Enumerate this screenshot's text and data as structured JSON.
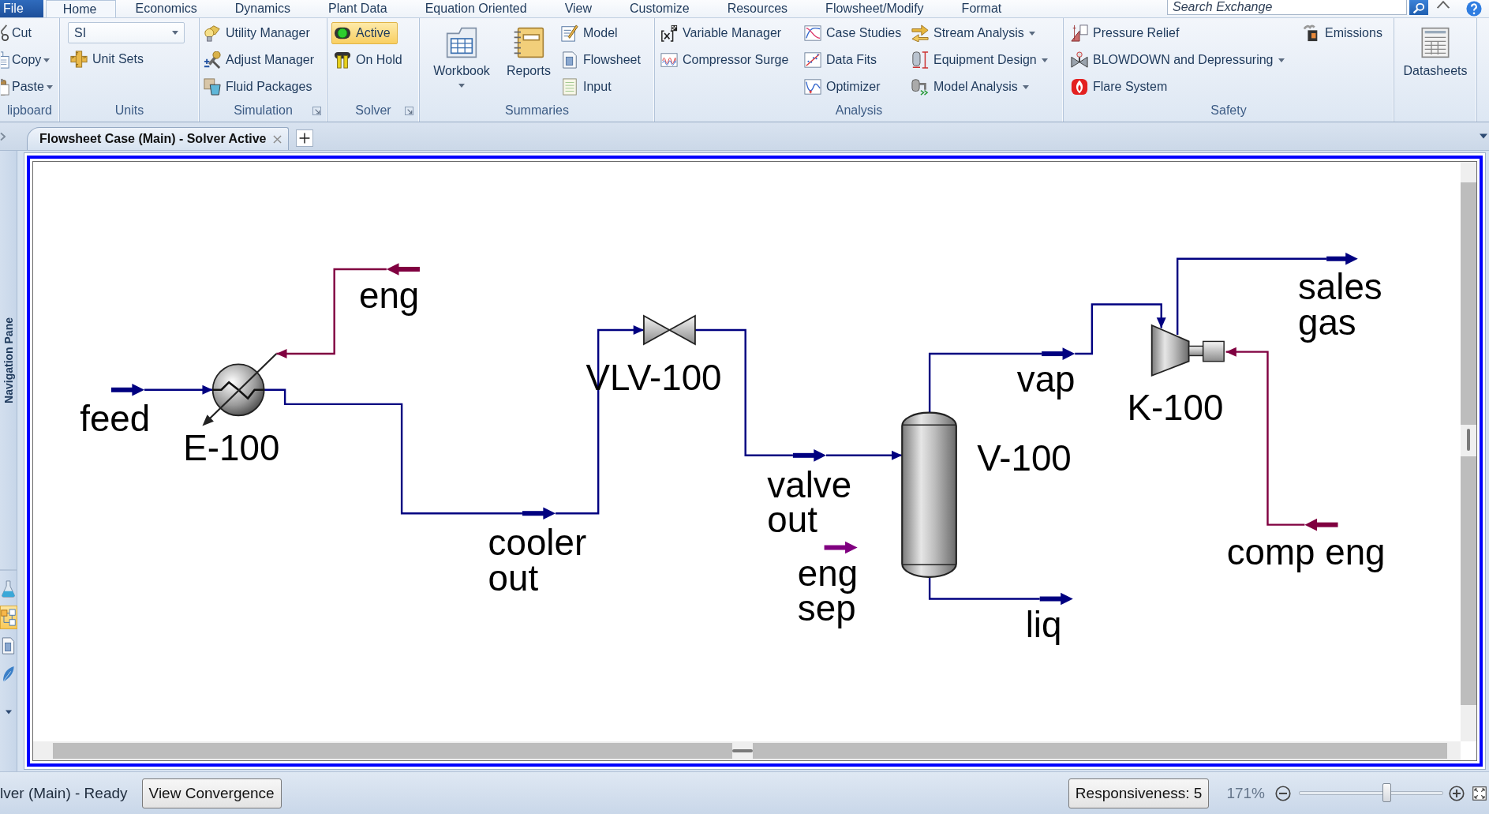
{
  "menu_tabs": [
    {
      "label": "File",
      "kind": "file",
      "selected": false
    },
    {
      "label": "Home",
      "kind": "tab",
      "selected": true
    },
    {
      "label": "Economics",
      "kind": "tab",
      "selected": false
    },
    {
      "label": "Dynamics",
      "kind": "tab",
      "selected": false
    },
    {
      "label": "Plant Data",
      "kind": "tab",
      "selected": false
    },
    {
      "label": "Equation Oriented",
      "kind": "tab",
      "selected": false
    },
    {
      "label": "View",
      "kind": "tab",
      "selected": false
    },
    {
      "label": "Customize",
      "kind": "tab",
      "selected": false
    },
    {
      "label": "Resources",
      "kind": "tab",
      "selected": false
    },
    {
      "label": "Flowsheet/Modify",
      "kind": "tab",
      "selected": false
    },
    {
      "label": "Format",
      "kind": "tab",
      "selected": false
    }
  ],
  "search": {
    "placeholder": "Search Exchange"
  },
  "ribbon": {
    "groups": [
      {
        "label": "lipboard",
        "columns": [
          [
            {
              "kind": "small",
              "label": "Cut",
              "dropdown": false
            },
            {
              "kind": "small",
              "label": "Copy",
              "dropdown": true
            },
            {
              "kind": "small",
              "label": "Paste",
              "dropdown": true
            }
          ]
        ]
      },
      {
        "label": "Units",
        "columns": [
          [
            {
              "kind": "select",
              "value": "SI"
            },
            {
              "kind": "small",
              "label": "Unit Sets",
              "dropdown": false
            }
          ]
        ]
      },
      {
        "label": "Simulation",
        "dialog_launcher": true,
        "columns": [
          [
            {
              "kind": "small",
              "label": "Utility Manager",
              "dropdown": false
            },
            {
              "kind": "small",
              "label": "Adjust Manager",
              "dropdown": false
            },
            {
              "kind": "small",
              "label": "Fluid Packages",
              "dropdown": false
            }
          ]
        ]
      },
      {
        "label": "Solver",
        "dialog_launcher": true,
        "columns": [
          [
            {
              "kind": "toggle",
              "label": "Active",
              "selected": true
            },
            {
              "kind": "toggle",
              "label": "On Hold",
              "selected": false
            }
          ]
        ]
      },
      {
        "label": "Summaries",
        "columns": [
          [
            {
              "kind": "large",
              "label": "Workbook",
              "dropdown": true
            }
          ],
          [
            {
              "kind": "large",
              "label": "Reports",
              "dropdown": false
            }
          ],
          [
            {
              "kind": "small",
              "label": "Model",
              "dropdown": false
            },
            {
              "kind": "small",
              "label": "Flowsheet",
              "dropdown": false
            },
            {
              "kind": "small",
              "label": "Input",
              "dropdown": false
            }
          ]
        ]
      },
      {
        "label": "Analysis",
        "columns": [
          [
            {
              "kind": "small",
              "label": "Variable Manager",
              "dropdown": false
            },
            {
              "kind": "small",
              "label": "Compressor Surge",
              "dropdown": false
            }
          ],
          [
            {
              "kind": "small",
              "label": "Case Studies",
              "dropdown": false
            },
            {
              "kind": "small",
              "label": "Data Fits",
              "dropdown": false
            },
            {
              "kind": "small",
              "label": "Optimizer",
              "dropdown": false
            }
          ],
          [
            {
              "kind": "small",
              "label": "Stream Analysis",
              "dropdown": true
            },
            {
              "kind": "small",
              "label": "Equipment Design",
              "dropdown": true
            },
            {
              "kind": "small",
              "label": "Model Analysis",
              "dropdown": true
            }
          ]
        ]
      },
      {
        "label": "Safety",
        "columns": [
          [
            {
              "kind": "small",
              "label": "Pressure Relief",
              "dropdown": false
            },
            {
              "kind": "small",
              "label": "BLOWDOWN and Depressuring",
              "dropdown": true
            },
            {
              "kind": "small",
              "label": "Flare System",
              "dropdown": false
            }
          ],
          [
            {
              "kind": "small",
              "label": "Emissions",
              "dropdown": false
            }
          ]
        ]
      },
      {
        "columns": [
          [
            {
              "kind": "large",
              "label": "Datasheets",
              "dropdown": false
            }
          ]
        ]
      }
    ]
  },
  "document_tabs": [
    {
      "label": "Flowsheet Case (Main) - Solver Active",
      "selected": true
    }
  ],
  "navigation_pane": {
    "title": "Navigation Pane",
    "items": [
      {
        "selected": false
      },
      {
        "selected": true
      },
      {
        "selected": false
      },
      {
        "selected": false
      }
    ]
  },
  "flowsheet": {
    "units": [
      {
        "kind": "heat_exchanger",
        "label": "E-100"
      },
      {
        "kind": "valve",
        "label": "VLV-100"
      },
      {
        "kind": "separator",
        "label": "V-100"
      },
      {
        "kind": "compressor",
        "label": "K-100"
      }
    ],
    "streams": [
      {
        "label_lines": [
          "feed"
        ],
        "color": "#000080"
      },
      {
        "label_lines": [
          "eng"
        ],
        "color": "#800040"
      },
      {
        "label_lines": [
          "cooler",
          "out"
        ],
        "color": "#000080"
      },
      {
        "label_lines": [
          "valve",
          "out"
        ],
        "color": "#000080"
      },
      {
        "label_lines": [
          "eng",
          "sep"
        ],
        "color": "#800080"
      },
      {
        "label_lines": [
          "vap"
        ],
        "color": "#000080"
      },
      {
        "label_lines": [
          "liq"
        ],
        "color": "#000080"
      },
      {
        "label_lines": [
          "sales",
          "gas"
        ],
        "color": "#000080"
      },
      {
        "label_lines": [
          "comp eng"
        ],
        "color": "#800040"
      }
    ]
  },
  "status_bar": {
    "message": "lver (Main) - Ready",
    "buttons": [
      {
        "label": "View Convergence"
      }
    ],
    "responsiveness": {
      "label": "Responsiveness: 5"
    },
    "zoom": {
      "reading": "171%",
      "level": 0.61
    }
  }
}
